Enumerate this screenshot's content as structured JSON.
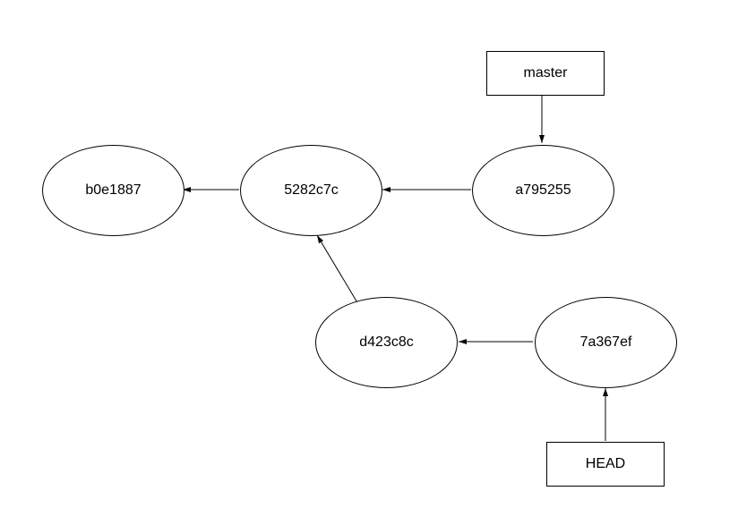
{
  "refs": {
    "master": "master",
    "head": "HEAD"
  },
  "commits": {
    "c1": "b0e1887",
    "c2": "5282c7c",
    "c3": "a795255",
    "c4": "d423c8c",
    "c5": "7a367ef"
  },
  "graph": {
    "nodes": [
      {
        "id": "c1",
        "label": "b0e1887",
        "type": "commit"
      },
      {
        "id": "c2",
        "label": "5282c7c",
        "type": "commit"
      },
      {
        "id": "c3",
        "label": "a795255",
        "type": "commit"
      },
      {
        "id": "c4",
        "label": "d423c8c",
        "type": "commit"
      },
      {
        "id": "c5",
        "label": "7a367ef",
        "type": "commit"
      },
      {
        "id": "master",
        "label": "master",
        "type": "ref"
      },
      {
        "id": "head",
        "label": "HEAD",
        "type": "ref"
      }
    ],
    "edges": [
      {
        "from": "c2",
        "to": "c1"
      },
      {
        "from": "c3",
        "to": "c2"
      },
      {
        "from": "c4",
        "to": "c2"
      },
      {
        "from": "c5",
        "to": "c4"
      },
      {
        "from": "master",
        "to": "c3"
      },
      {
        "from": "head",
        "to": "c5"
      }
    ]
  }
}
